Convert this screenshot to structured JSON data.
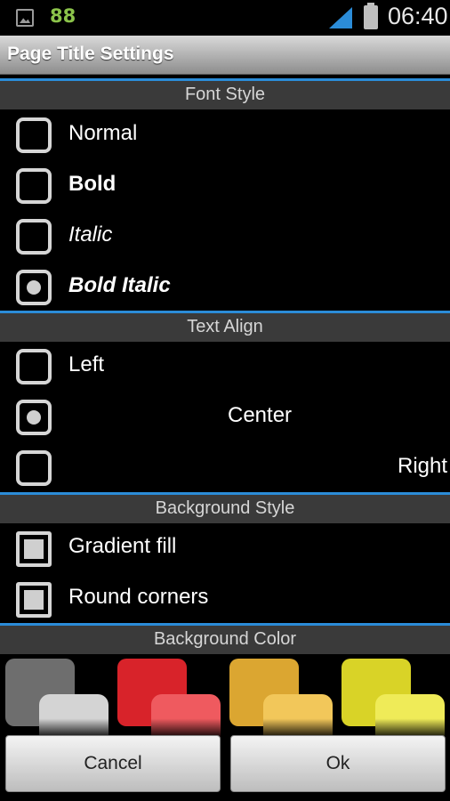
{
  "status_bar": {
    "notification_count": "88",
    "time": "06:40",
    "accent_color": "#2b8cd8"
  },
  "title_bar": {
    "title": "Page Title Settings"
  },
  "font_style": {
    "header": "Font Style",
    "options": [
      {
        "label": "Normal",
        "selected": false
      },
      {
        "label": "Bold",
        "selected": false
      },
      {
        "label": "Italic",
        "selected": false
      },
      {
        "label": "Bold Italic",
        "selected": true
      }
    ]
  },
  "text_align": {
    "header": "Text Align",
    "options": [
      {
        "label": "Left",
        "selected": false
      },
      {
        "label": "Center",
        "selected": true
      },
      {
        "label": "Right",
        "selected": false
      }
    ]
  },
  "background_style": {
    "header": "Background Style",
    "options": [
      {
        "label": "Gradient fill",
        "checked": true
      },
      {
        "label": "Round corners",
        "checked": true
      }
    ]
  },
  "background_color": {
    "header": "Background Color",
    "swatches": [
      {
        "name": "gray",
        "back": "#6e6e6e",
        "front": "#d4d4d4"
      },
      {
        "name": "red",
        "back": "#d8232a",
        "front": "#ef5a5f"
      },
      {
        "name": "orange",
        "back": "#dba631",
        "front": "#f2c75a"
      },
      {
        "name": "yellow",
        "back": "#d9d327",
        "front": "#efeb58"
      }
    ]
  },
  "buttons": {
    "cancel": "Cancel",
    "ok": "Ok"
  }
}
